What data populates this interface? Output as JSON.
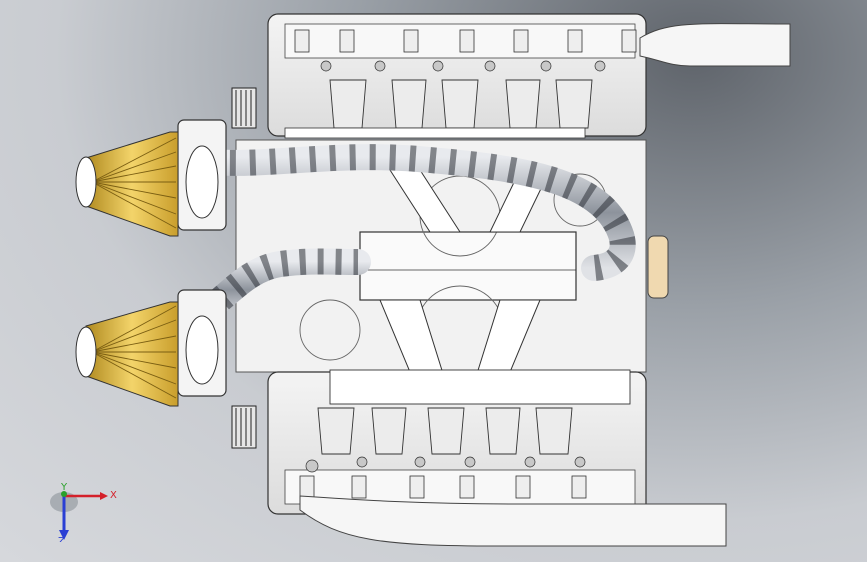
{
  "viewport": {
    "background_top": "#5f646b",
    "background_bottom": "#d6d8dc"
  },
  "triad": {
    "x_label": "X",
    "y_label": "Y",
    "z_label": "Z",
    "x_color": "#d4202a",
    "y_color": "#2aa02a",
    "z_color": "#2a3fd4"
  },
  "model": {
    "part_name": "engine-assembly",
    "filter_color": "#e8c14a",
    "hose_color": "#6a6f78"
  }
}
